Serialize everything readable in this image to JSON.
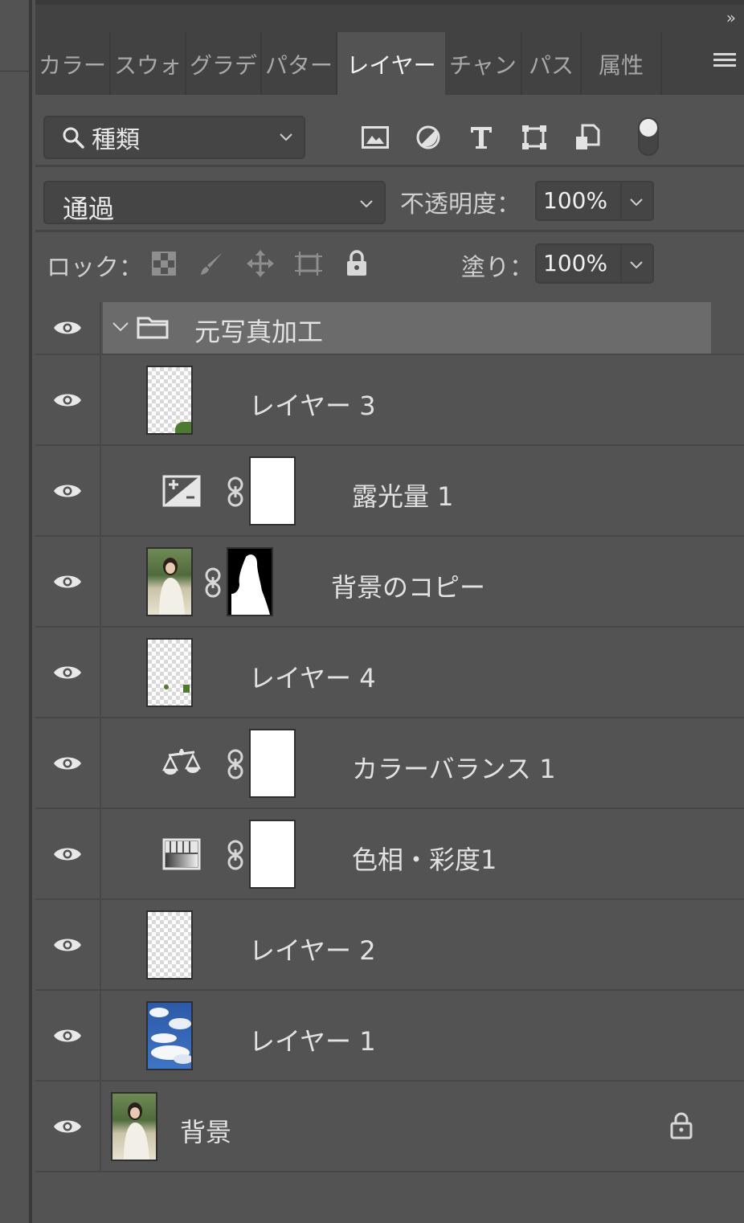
{
  "collapse_glyph": "»",
  "tabs": [
    {
      "label": "カラー",
      "active": false
    },
    {
      "label": "スウォ",
      "active": false
    },
    {
      "label": "グラデ",
      "active": false
    },
    {
      "label": "パター",
      "active": false
    },
    {
      "label": "レイヤー",
      "active": true
    },
    {
      "label": "チャン",
      "active": false
    },
    {
      "label": "パス",
      "active": false
    },
    {
      "label": "属性",
      "active": false
    }
  ],
  "filter": {
    "kind_label": "種類"
  },
  "blend": {
    "mode": "通過",
    "opacity_label": "不透明度：",
    "opacity_value": "100%"
  },
  "lock": {
    "label": "ロック：",
    "fill_label": "塗り：",
    "fill_value": "100%"
  },
  "layers": [
    {
      "name": "元写真加工",
      "type": "group"
    },
    {
      "name": "レイヤー 3",
      "type": "pixel"
    },
    {
      "name": "露光量 1",
      "type": "exposure"
    },
    {
      "name": "背景のコピー",
      "type": "masked"
    },
    {
      "name": "レイヤー 4",
      "type": "pixel"
    },
    {
      "name": "カラーバランス 1",
      "type": "colorbalance"
    },
    {
      "name": "色相・彩度1",
      "type": "huesat"
    },
    {
      "name": "レイヤー 2",
      "type": "pixel"
    },
    {
      "name": "レイヤー 1",
      "type": "sky"
    },
    {
      "name": "背景",
      "type": "background"
    }
  ],
  "colors": {
    "panel_bg": "#535353",
    "header_bg": "#424242",
    "group_bg": "#6b6b6b",
    "text": "#e2e2e2"
  }
}
